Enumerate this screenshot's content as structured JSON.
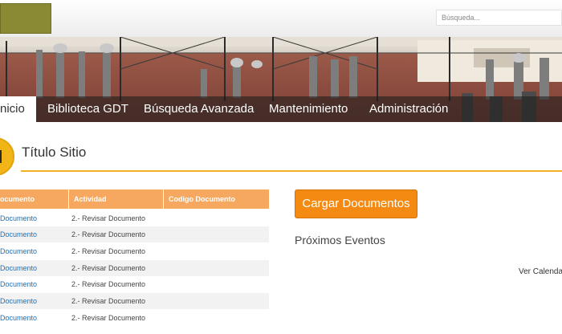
{
  "search": {
    "placeholder": "Búsqueda..."
  },
  "nav": {
    "tabs": [
      {
        "label": "nicio"
      },
      {
        "label": "Biblioteca GDT"
      },
      {
        "label": "Búsqueda Avanzada"
      },
      {
        "label": "Mantenimiento"
      },
      {
        "label": "Administración"
      }
    ]
  },
  "site": {
    "title": "Título Sitio"
  },
  "table": {
    "columns": [
      "ocumento",
      "Actividad",
      "Codigo Documento"
    ],
    "rows": [
      {
        "document": "Documento",
        "activity": "2.- Revisar Documento",
        "code": ""
      },
      {
        "document": "Documento",
        "activity": "2.- Revisar Documento",
        "code": ""
      },
      {
        "document": "Documento",
        "activity": "2.- Revisar Documento",
        "code": ""
      },
      {
        "document": "Documento",
        "activity": "2.- Revisar Documento",
        "code": ""
      },
      {
        "document": "Documento",
        "activity": "2.- Revisar Documento",
        "code": ""
      },
      {
        "document": "Documento",
        "activity": "2.- Revisar Documento",
        "code": ""
      },
      {
        "document": "Documento",
        "activity": "2.- Revisar Documento",
        "code": ""
      }
    ]
  },
  "actions": {
    "upload_label": "Cargar Documentos"
  },
  "events": {
    "title": "Próximos Eventos",
    "calendar_link": "Ver Calendar"
  },
  "colors": {
    "accent": "#f48a12",
    "header_orange": "#f6a860",
    "title_line": "#f0b123",
    "link": "#1f6fb5"
  }
}
